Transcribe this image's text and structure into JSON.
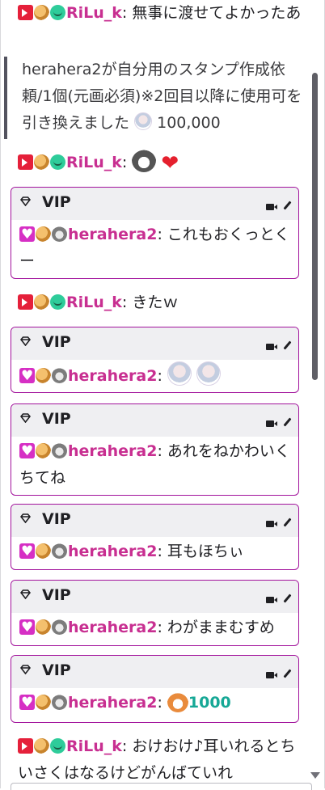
{
  "messages": [
    {
      "kind": "chat",
      "badges": [
        "broadcaster",
        "cookie",
        "sub"
      ],
      "name": "RiLu_k",
      "text": "無事に渡せてよかったあ"
    },
    {
      "kind": "system",
      "text": "herahera2が自分用のスタンプ作成依頼/1個(元画必須)※2回目以降に使用可を引き換えました",
      "amount": "100,000"
    },
    {
      "kind": "chat",
      "badges": [
        "broadcaster",
        "cookie",
        "sub"
      ],
      "name": "RiLu_k",
      "emotes": [
        "husky-emote",
        "heart-emote"
      ]
    },
    {
      "kind": "vip",
      "header": "VIP",
      "badges": [
        "heart",
        "cookie",
        "dog"
      ],
      "name": "herahera2",
      "text": "これもおくっとくー"
    },
    {
      "kind": "chat",
      "badges": [
        "broadcaster",
        "cookie",
        "sub"
      ],
      "name": "RiLu_k",
      "text": "きたｗ"
    },
    {
      "kind": "vip",
      "header": "VIP",
      "badges": [
        "heart",
        "cookie",
        "dog"
      ],
      "name": "herahera2",
      "emotes": [
        "girl-emote",
        "girl-emote"
      ]
    },
    {
      "kind": "vip",
      "header": "VIP",
      "badges": [
        "heart",
        "cookie",
        "dog"
      ],
      "name": "herahera2",
      "text": "あれをねかわいくちてね"
    },
    {
      "kind": "vip",
      "header": "VIP",
      "badges": [
        "heart",
        "cookie",
        "dog"
      ],
      "name": "herahera2",
      "text": "耳もほちぃ"
    },
    {
      "kind": "vip",
      "header": "VIP",
      "badges": [
        "heart",
        "cookie",
        "dog"
      ],
      "name": "herahera2",
      "text": "わがままむすめ"
    },
    {
      "kind": "vip",
      "header": "VIP",
      "badges": [
        "heart",
        "cookie",
        "dog"
      ],
      "name": "herahera2",
      "emotes": [
        "shiba-emote"
      ],
      "cheer": "1000"
    },
    {
      "kind": "chat",
      "badges": [
        "broadcaster",
        "cookie",
        "sub"
      ],
      "name": "RiLu_k",
      "text": "おけおけ♪耳いれるとちいさくはなるけどがんばていれ"
    }
  ],
  "colors": {
    "username": "#c82f91",
    "vip_border": "#a2139c",
    "vip_header_bg": "#efeff2",
    "cheer": "#16a896"
  },
  "separator": ": "
}
